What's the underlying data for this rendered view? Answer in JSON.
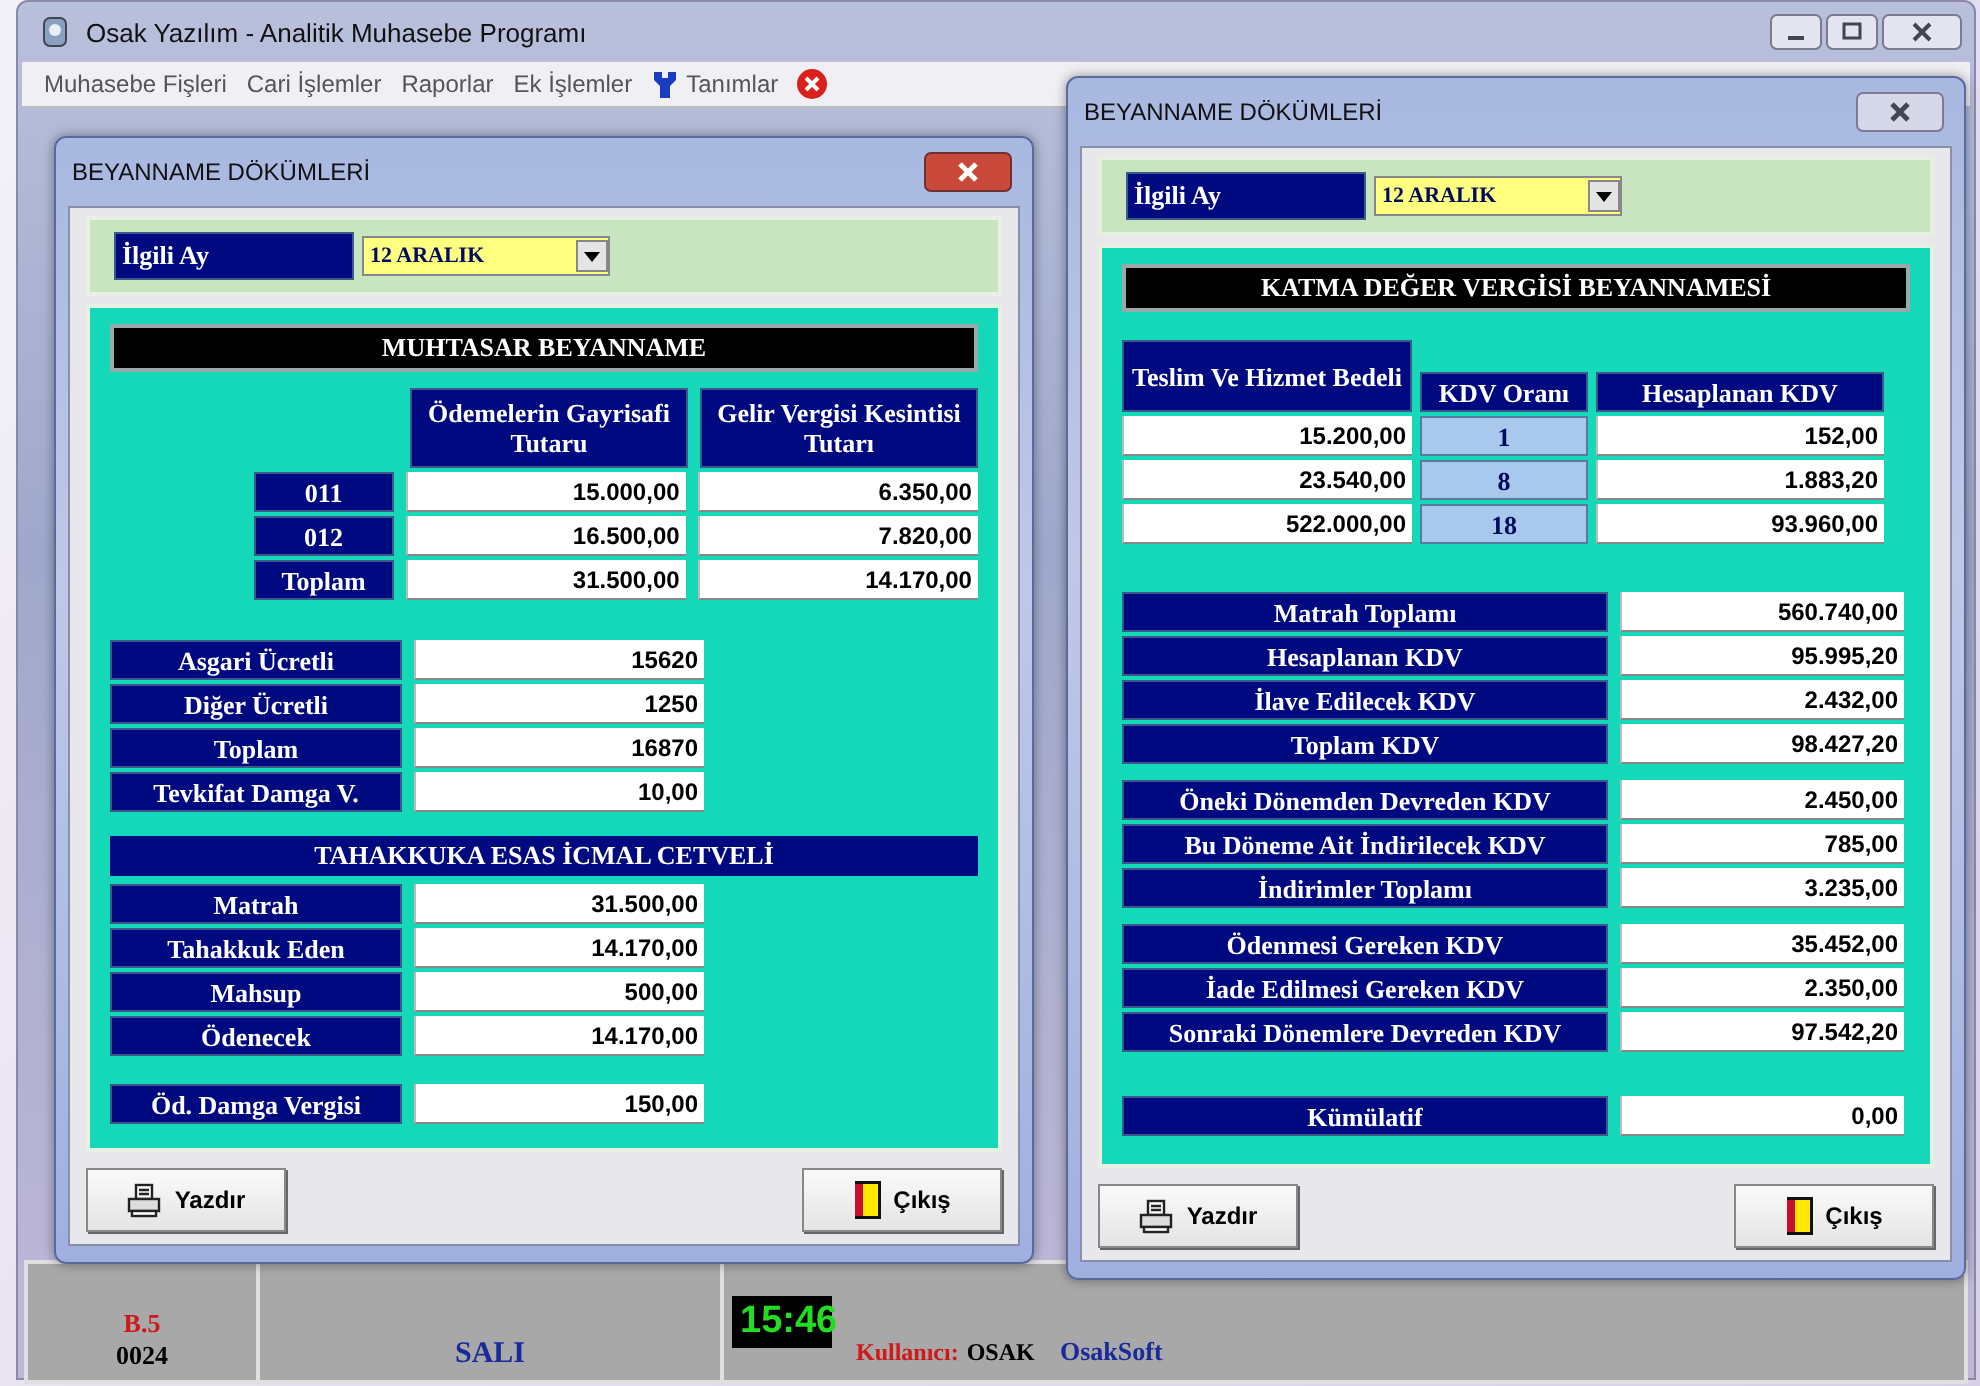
{
  "window": {
    "title": "Osak Yazılım - Analitik Muhasebe Programı"
  },
  "menu": [
    {
      "label": "Muhasebe Fişleri",
      "kind": "text"
    },
    {
      "label": "Cari İşlemler",
      "kind": "text"
    },
    {
      "label": "Raporlar",
      "kind": "text"
    },
    {
      "label": "Ek İşlemler",
      "kind": "text"
    },
    {
      "label": "Tanımlar",
      "kind": "tool"
    }
  ],
  "dialogs": [
    {
      "kind": "muhtasar",
      "title": "BEYANNAME DÖKÜMLERİ",
      "active": true,
      "month": {
        "label": "İlgili Ay",
        "value": "12 ARALIK"
      },
      "section_title": "MUHTASAR  BEYANNAME",
      "columns": [
        "Ödemelerin Gayrisafi Tutaru",
        "Gelir Vergisi Kesintisi Tutarı"
      ],
      "rows": [
        {
          "label": "011",
          "values": [
            "15.000,00",
            "6.350,00"
          ]
        },
        {
          "label": "012",
          "values": [
            "16.500,00",
            "7.820,00"
          ]
        },
        {
          "label": "Toplam",
          "values": [
            "31.500,00",
            "14.170,00"
          ]
        }
      ],
      "wage_rows": [
        {
          "label": "Asgari Ücretli",
          "value": "15620"
        },
        {
          "label": "Diğer Ücretli",
          "value": "1250"
        },
        {
          "label": "Toplam",
          "value": "16870"
        },
        {
          "label": "Tevkifat Damga V.",
          "value": "10,00"
        }
      ],
      "icmal_title": "TAHAKKUKA ESAS İCMAL CETVELİ",
      "icmal_rows": [
        {
          "label": "Matrah",
          "value": "31.500,00"
        },
        {
          "label": "Tahakkuk Eden",
          "value": "14.170,00"
        },
        {
          "label": "Mahsup",
          "value": "500,00"
        },
        {
          "label": "Ödenecek",
          "value": "14.170,00"
        }
      ],
      "stamp_row": {
        "label": "Öd. Damga Vergisi",
        "value": "150,00"
      },
      "buttons": [
        {
          "label": "Yazdır",
          "kind": "print"
        },
        {
          "label": "Çıkış",
          "kind": "exit"
        }
      ]
    },
    {
      "kind": "kdv",
      "title": "BEYANNAME DÖKÜMLERİ",
      "active": false,
      "month": {
        "label": "İlgili Ay",
        "value": "12 ARALIK"
      },
      "section_title": "KATMA DEĞER VERGİSİ BEYANNAMESİ",
      "columns": [
        "Teslim Ve Hizmet Bedeli",
        "KDV Oranı",
        "Hesaplanan KDV"
      ],
      "rows": [
        {
          "base": "15.200,00",
          "rate": "1",
          "tax": "152,00"
        },
        {
          "base": "23.540,00",
          "rate": "8",
          "tax": "1.883,20"
        },
        {
          "base": "522.000,00",
          "rate": "18",
          "tax": "93.960,00"
        }
      ],
      "summary_groups": [
        {
          "rows": [
            {
              "label": "Matrah Toplamı",
              "value": "560.740,00"
            },
            {
              "label": "Hesaplanan KDV",
              "value": "95.995,20"
            },
            {
              "label": "İlave Edilecek KDV",
              "value": "2.432,00"
            },
            {
              "label": "Toplam  KDV",
              "value": "98.427,20"
            }
          ]
        },
        {
          "rows": [
            {
              "label": "Öneki Dönemden Devreden  KDV",
              "value": "2.450,00"
            },
            {
              "label": "Bu Döneme Ait İndirilecek KDV",
              "value": "785,00"
            },
            {
              "label": "İndirimler Toplamı",
              "value": "3.235,00"
            }
          ]
        },
        {
          "rows": [
            {
              "label": "Ödenmesi Gereken KDV",
              "value": "35.452,00"
            },
            {
              "label": "İade Edilmesi Gereken  KDV",
              "value": "2.350,00"
            },
            {
              "label": "Sonraki Dönemlere Devreden KDV",
              "value": "97.542,20"
            }
          ]
        },
        {
          "rows": [
            {
              "label": "Kümülatif",
              "value": "0,00"
            }
          ]
        }
      ],
      "buttons": [
        {
          "label": "Yazdır",
          "kind": "print"
        },
        {
          "label": "Çıkış",
          "kind": "exit"
        }
      ]
    }
  ],
  "status_bar": {
    "code": "B.5",
    "number": "0024",
    "day": "SALI",
    "clock": "15:46",
    "user_label": "Kullanıcı:",
    "user": "OSAK",
    "company": "OsakSoft"
  }
}
